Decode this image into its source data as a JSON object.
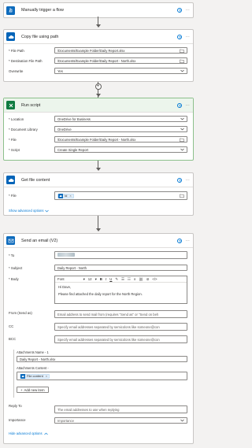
{
  "trigger": {
    "title": "Manually trigger a flow"
  },
  "copy_file": {
    "title": "Copy file using path",
    "fields": [
      {
        "label": "* File Path",
        "value": "/Documents/Example Folder/Daily Report.xlsx"
      },
      {
        "label": "* Destination File Path",
        "value": "/Documents/Example Folder/Daily Report - North.xlsx"
      },
      {
        "label": "Overwrite",
        "value": "Yes"
      }
    ]
  },
  "run_script": {
    "title": "Run script",
    "fields": [
      {
        "label": "* Location",
        "value": "OneDrive for Business"
      },
      {
        "label": "* Document Library",
        "value": "OneDrive"
      },
      {
        "label": "* File",
        "value": "/Documents/Example Folder/Daily Report - North.xlsx"
      },
      {
        "label": "* Script",
        "value": "Create Single Report"
      }
    ]
  },
  "get_file": {
    "title": "Get file content",
    "file_label": "* File",
    "file_chip": "Id",
    "advanced_link": "Show advanced options"
  },
  "send_email": {
    "title": "Send an email (V2)",
    "to_label": "* To",
    "subject_label": "* Subject",
    "subject_value": "Daily Report - North",
    "body_label": "* Body",
    "toolbar": {
      "font": "Font",
      "size": "12"
    },
    "body_lines": [
      "Hi Dave,",
      "Please find attached the daily report for the North Region."
    ],
    "from_label": "From (Send as)",
    "from_placeholder": "Email address to send mail from (requires \"Send as\" or \"Send on beh",
    "cc_label": "CC",
    "cc_placeholder": "Specify email addresses separated by semicolons like someone@con",
    "bcc_label": "BCC",
    "bcc_placeholder": "Specify email addresses separated by semicolons like someone@con",
    "attachments_name_label": "Attachments Name - 1",
    "attachments_name_value": "Daily Report - North.xlsx",
    "attachments_content_label": "Attachments Content -",
    "attachments_content_chip": "File content",
    "add_item": "Add new item",
    "reply_to_label": "Reply To",
    "reply_to_placeholder": "The email addresses to use when replying",
    "importance_label": "Importance",
    "importance_value": "Importance",
    "advanced_link": "Hide advanced options"
  },
  "icons": {
    "trigger": "hand-touch-icon",
    "onedrive": "cloud-icon",
    "excel": "excel-icon",
    "outlook": "outlook-icon"
  },
  "colors": {
    "trigger": "#0f6cbd",
    "onedrive": "#0364b8",
    "excel": "#107c41",
    "outlook": "#0f6cbd",
    "link": "#0078d4"
  }
}
